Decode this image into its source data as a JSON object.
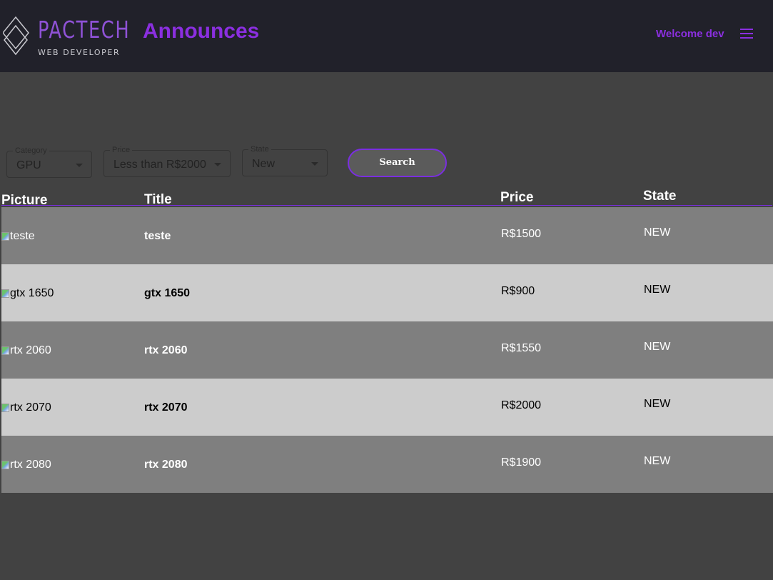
{
  "header": {
    "logo_name": "PACTECH",
    "logo_tagline": "WEB DEVELOPER",
    "page_title": "Announces",
    "welcome": "Welcome dev",
    "menu_icon": "hamburger-menu-icon"
  },
  "filters": {
    "category": {
      "label": "Category",
      "value": "GPU"
    },
    "price": {
      "label": "Price",
      "value": "Less than R$2000"
    },
    "state": {
      "label": "State",
      "value": "New"
    },
    "search_label": "Search"
  },
  "table": {
    "columns": [
      "Picture",
      "Title",
      "Price",
      "State"
    ],
    "rows": [
      {
        "picture_alt": "teste",
        "title": "teste",
        "price": "R$1500",
        "state": "NEW"
      },
      {
        "picture_alt": "gtx 1650",
        "title": "gtx 1650",
        "price": "R$900",
        "state": "NEW"
      },
      {
        "picture_alt": "rtx 2060",
        "title": "rtx 2060",
        "price": "R$1550",
        "state": "NEW"
      },
      {
        "picture_alt": "rtx 2070",
        "title": "rtx 2070",
        "price": "R$2000",
        "state": "NEW"
      },
      {
        "picture_alt": "rtx 2080",
        "title": "rtx 2080",
        "price": "R$1900",
        "state": "NEW"
      }
    ]
  },
  "colors": {
    "accent": "#8b2fe0",
    "topbar": "#21212a",
    "background": "#424242",
    "row_dark": "#7f7f7f",
    "row_light": "#cccccc"
  }
}
